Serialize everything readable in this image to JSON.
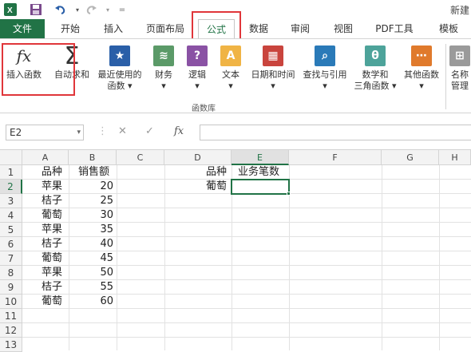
{
  "titlebar": {
    "title": "新建"
  },
  "tabs": [
    {
      "label": "文件"
    },
    {
      "label": "开始"
    },
    {
      "label": "插入"
    },
    {
      "label": "页面布局"
    },
    {
      "label": "公式"
    },
    {
      "label": "数据"
    },
    {
      "label": "审阅"
    },
    {
      "label": "视图"
    },
    {
      "label": "PDF工具"
    },
    {
      "label": "模板"
    }
  ],
  "ribbon": {
    "buttons": [
      {
        "label": "插入函数",
        "icon": "fx-icon"
      },
      {
        "label": "自动求和",
        "icon": "sigma-icon"
      },
      {
        "label": "最近使用的\n函数 ▾",
        "icon": "star-icon"
      },
      {
        "label": "财务\n▾",
        "icon": "coins-icon"
      },
      {
        "label": "逻辑\n▾",
        "icon": "question-icon"
      },
      {
        "label": "文本\n▾",
        "icon": "text-a-icon"
      },
      {
        "label": "日期和时间\n▾",
        "icon": "calendar-icon"
      },
      {
        "label": "查找与引用\n▾",
        "icon": "magnifier-icon"
      },
      {
        "label": "数学和\n三角函数 ▾",
        "icon": "theta-icon"
      },
      {
        "label": "其他函数\n▾",
        "icon": "more-functions-icon"
      },
      {
        "label": "名称\n管理",
        "icon": "name-manager-icon"
      }
    ],
    "group_label": "函数库"
  },
  "formula_bar": {
    "name_box": "E2",
    "value": ""
  },
  "grid": {
    "columns": [
      "A",
      "B",
      "C",
      "D",
      "E",
      "F",
      "G",
      "H"
    ],
    "rows": [
      "1",
      "2",
      "3",
      "4",
      "5",
      "6",
      "7",
      "8",
      "9",
      "10",
      "11",
      "12",
      "13"
    ],
    "selected_cell": "E2",
    "cells": {
      "A1": "品种",
      "B1": "销售额",
      "A2": "苹果",
      "B2": "20",
      "A3": "桔子",
      "B3": "25",
      "A4": "葡萄",
      "B4": "30",
      "A5": "苹果",
      "B5": "35",
      "A6": "桔子",
      "B6": "40",
      "A7": "葡萄",
      "B7": "45",
      "A8": "苹果",
      "B8": "50",
      "A9": "桔子",
      "B9": "55",
      "A10": "葡萄",
      "B10": "60",
      "D1": "品种",
      "E1": "业务笔数",
      "D2": "葡萄"
    }
  },
  "colors": {
    "accent": "#217346",
    "highlight": "#e0363a"
  }
}
